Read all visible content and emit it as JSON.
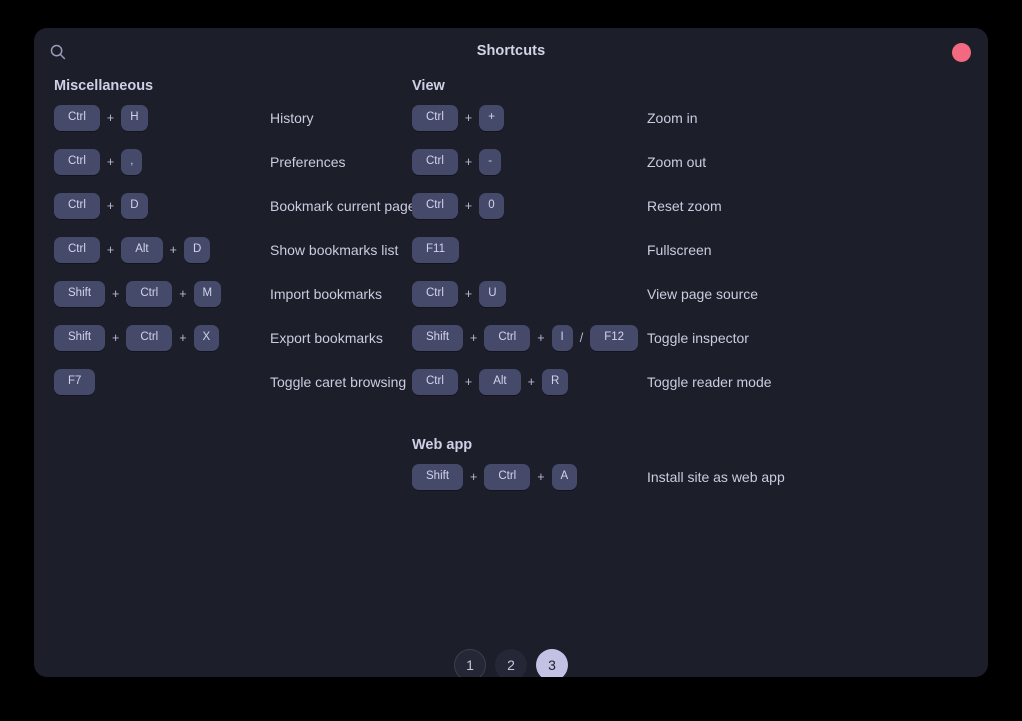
{
  "window": {
    "title": "Shortcuts",
    "search_icon": "search-icon",
    "close_icon": "close-circle-icon",
    "accent_close": "#f3697f",
    "bg": "#1c1e2a",
    "key_bg": "#454a6b",
    "active_page_bg": "#c4c2e4"
  },
  "columns": [
    {
      "id": "left",
      "sections": [
        {
          "title": "Miscellaneous",
          "rows": [
            {
              "keys": [
                "Ctrl",
                "H"
              ],
              "seps": [
                "+"
              ],
              "desc": "History"
            },
            {
              "keys": [
                "Ctrl",
                ","
              ],
              "seps": [
                "+"
              ],
              "desc": "Preferences"
            },
            {
              "keys": [
                "Ctrl",
                "D"
              ],
              "seps": [
                "+"
              ],
              "desc": "Bookmark current page"
            },
            {
              "keys": [
                "Ctrl",
                "Alt",
                "D"
              ],
              "seps": [
                "+",
                "+"
              ],
              "desc": "Show bookmarks list"
            },
            {
              "keys": [
                "Shift",
                "Ctrl",
                "M"
              ],
              "seps": [
                "+",
                "+"
              ],
              "desc": "Import bookmarks"
            },
            {
              "keys": [
                "Shift",
                "Ctrl",
                "X"
              ],
              "seps": [
                "+",
                "+"
              ],
              "desc": "Export bookmarks"
            },
            {
              "keys": [
                "F7"
              ],
              "seps": [],
              "desc": "Toggle caret browsing"
            }
          ]
        }
      ]
    },
    {
      "id": "right",
      "sections": [
        {
          "title": "View",
          "rows": [
            {
              "keys": [
                "Ctrl",
                "+"
              ],
              "seps": [
                "+"
              ],
              "desc": "Zoom in"
            },
            {
              "keys": [
                "Ctrl",
                "-"
              ],
              "seps": [
                "+"
              ],
              "desc": "Zoom out"
            },
            {
              "keys": [
                "Ctrl",
                "0"
              ],
              "seps": [
                "+"
              ],
              "desc": "Reset zoom"
            },
            {
              "keys": [
                "F11"
              ],
              "seps": [],
              "desc": "Fullscreen"
            },
            {
              "keys": [
                "Ctrl",
                "U"
              ],
              "seps": [
                "+"
              ],
              "desc": "View page source"
            },
            {
              "keys": [
                "Shift",
                "Ctrl",
                "I",
                "F12"
              ],
              "seps": [
                "+",
                "+",
                "/"
              ],
              "desc": "Toggle inspector"
            },
            {
              "keys": [
                "Ctrl",
                "Alt",
                "R"
              ],
              "seps": [
                "+",
                "+"
              ],
              "desc": "Toggle reader mode"
            }
          ]
        },
        {
          "title": "Web app",
          "rows": [
            {
              "keys": [
                "Shift",
                "Ctrl",
                "A"
              ],
              "seps": [
                "+",
                "+"
              ],
              "desc": "Install site as web app"
            }
          ]
        }
      ]
    }
  ],
  "pagination": {
    "pages": [
      "1",
      "2",
      "3"
    ],
    "current": "3"
  }
}
